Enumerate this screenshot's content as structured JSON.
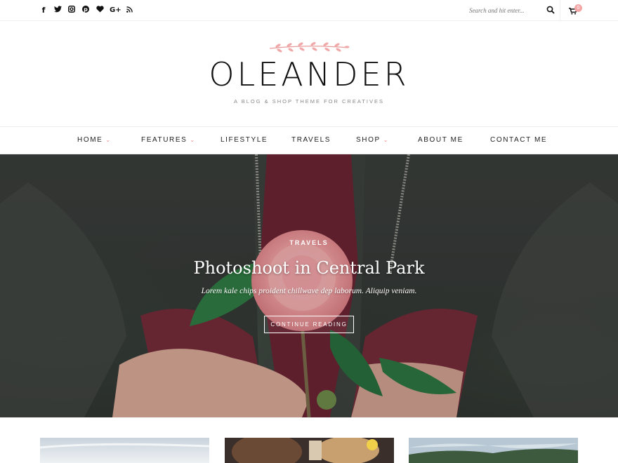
{
  "topbar": {
    "social_icons": [
      "facebook-icon",
      "twitter-icon",
      "instagram-icon",
      "pinterest-icon",
      "heart-icon",
      "google-plus-icon",
      "rss-icon"
    ],
    "search_placeholder": "Search and hit enter...",
    "cart_count": "0"
  },
  "brand": {
    "logo": "OLEANDER",
    "tagline": "A BLOG & SHOP THEME FOR CREATIVES",
    "accent": "#f08a8a"
  },
  "nav": {
    "items": [
      {
        "label": "HOME",
        "dropdown": true
      },
      {
        "label": "FEATURES",
        "dropdown": true
      },
      {
        "label": "LIFESTYLE",
        "dropdown": false
      },
      {
        "label": "TRAVELS",
        "dropdown": false
      },
      {
        "label": "SHOP",
        "dropdown": true
      },
      {
        "label": "ABOUT ME",
        "dropdown": false
      },
      {
        "label": "CONTACT ME",
        "dropdown": false
      }
    ]
  },
  "hero": {
    "category": "TRAVELS",
    "title": "Photoshoot in Central Park",
    "excerpt": "Lorem kale chips proident chillwave dep laborum. Aliquip veniam.",
    "button": "CONTINUE READING"
  }
}
